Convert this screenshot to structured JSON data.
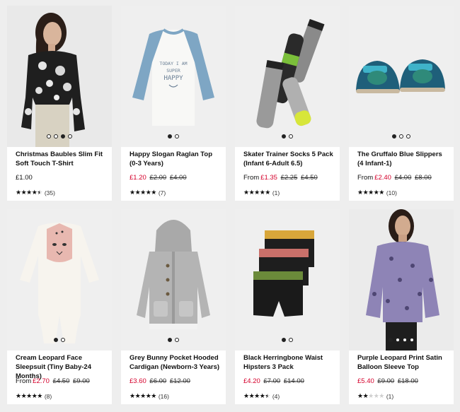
{
  "products": [
    {
      "title": "Christmas Baubles Slim Fit Soft Touch T-Shirt",
      "from": "",
      "price": "£1.00",
      "sale": false,
      "was": [],
      "rating": 4.5,
      "count": "(35)",
      "dots": 4,
      "active_dot": 2,
      "image": "woman-baubles-top"
    },
    {
      "title": "Happy Slogan Raglan Top (0-3 Years)",
      "from": "",
      "price": "£1.20",
      "sale": true,
      "was": [
        "£2.00",
        "£4.00"
      ],
      "rating": 5,
      "count": "(7)",
      "dots": 2,
      "active_dot": 0,
      "image": "raglan-top",
      "shirt_text": [
        "TODAY I AM",
        "SUPER",
        "HAPPY"
      ]
    },
    {
      "title": "Skater Trainer Socks 5 Pack (Infant 6-Adult 6.5)",
      "from": "From",
      "price": "£1.35",
      "sale": true,
      "was": [
        "£2.25",
        "£4.50"
      ],
      "rating": 5,
      "count": "(1)",
      "dots": 2,
      "active_dot": 0,
      "image": "socks"
    },
    {
      "title": "The Gruffalo Blue Slippers (4 Infant-1)",
      "from": "From",
      "price": "£2.40",
      "sale": true,
      "was": [
        "£4.00",
        "£8.00"
      ],
      "rating": 5,
      "count": "(10)",
      "dots": 3,
      "active_dot": 0,
      "image": "slippers"
    },
    {
      "title": "Cream Leopard Face Sleepsuit (Tiny Baby-24 Months)",
      "from": "From",
      "price": "£2.70",
      "sale": true,
      "was": [
        "£4.50",
        "£9.00"
      ],
      "rating": 5,
      "count": "(8)",
      "dots": 2,
      "active_dot": 0,
      "image": "sleepsuit"
    },
    {
      "title": "Grey Bunny Pocket Hooded Cardigan (Newborn-3 Years)",
      "from": "",
      "price": "£3.60",
      "sale": true,
      "was": [
        "£6.00",
        "£12.00"
      ],
      "rating": 5,
      "count": "(16)",
      "dots": 2,
      "active_dot": 0,
      "image": "cardigan"
    },
    {
      "title": "Black Herringbone Waist Hipsters 3 Pack",
      "from": "",
      "price": "£4.20",
      "sale": true,
      "was": [
        "£7.00",
        "£14.00"
      ],
      "rating": 4.5,
      "count": "(4)",
      "dots": 2,
      "active_dot": 0,
      "image": "hipsters"
    },
    {
      "title": "Purple Leopard Print Satin Balloon Sleeve Top",
      "from": "",
      "price": "£5.40",
      "sale": true,
      "was": [
        "£9.00",
        "£18.00"
      ],
      "rating": 2,
      "count": "(1)",
      "dots": 4,
      "active_dot": 0,
      "image": "woman-purple-top"
    }
  ],
  "colors": {
    "background": "#eeeeee",
    "card": "#ffffff",
    "sale_price": "#d5002b",
    "text": "#111111"
  }
}
